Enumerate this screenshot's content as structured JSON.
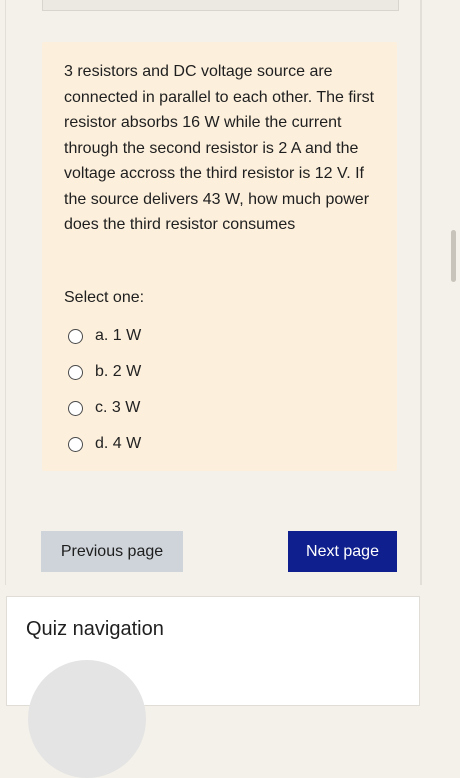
{
  "question": {
    "text": "3 resistors and DC voltage source are connected in parallel to each other. The first resistor absorbs 16 W while the current through the second resistor is 2 A and the voltage accross the third resistor is 12 V. If the source delivers 43 W, how much power does the third resistor consumes",
    "select_label": "Select one:",
    "answers": [
      {
        "label": "a. 1 W"
      },
      {
        "label": "b. 2 W"
      },
      {
        "label": "c. 3 W"
      },
      {
        "label": "d. 4 W"
      }
    ]
  },
  "buttons": {
    "previous": "Previous page",
    "next": "Next page"
  },
  "quiz_navigation": {
    "title": "Quiz navigation"
  },
  "colors": {
    "page_bg": "#f4f1ea",
    "question_bg": "#fcefdc",
    "next_button_bg": "#0f1f8e",
    "previous_button_bg": "#ced4da"
  }
}
